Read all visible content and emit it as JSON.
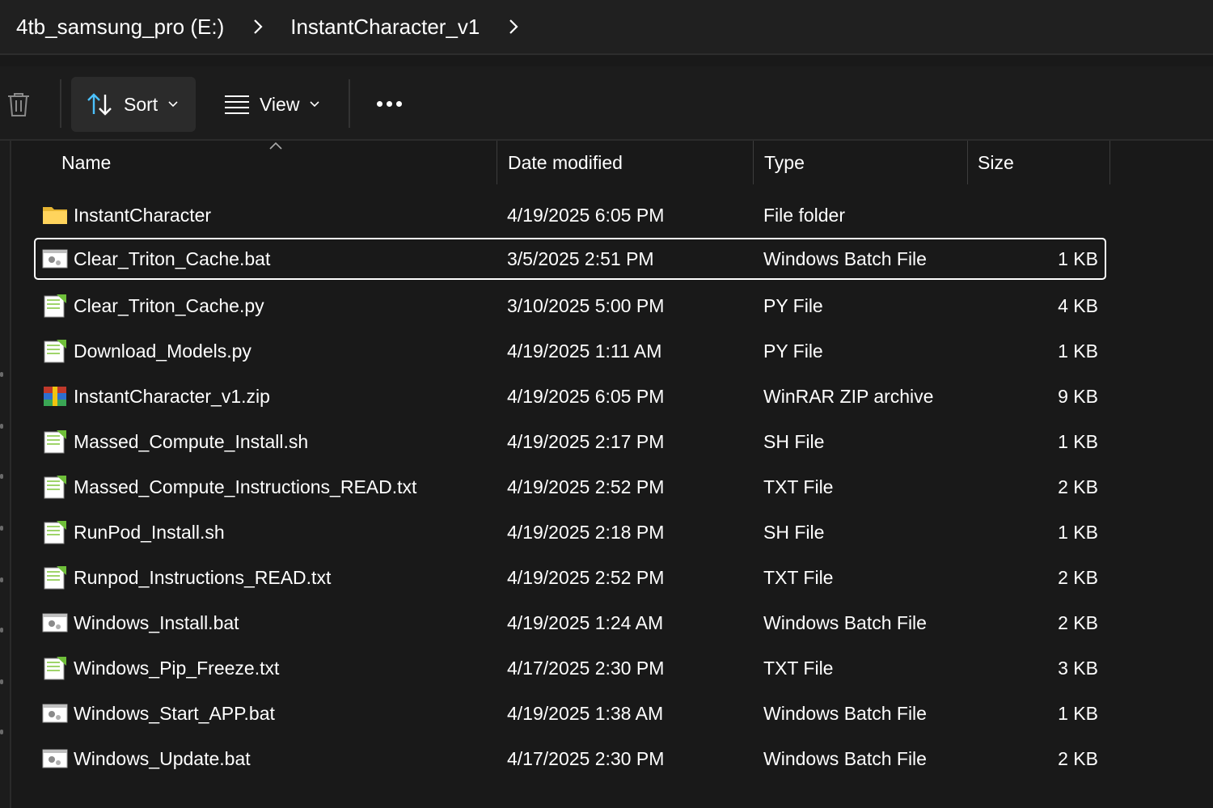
{
  "breadcrumb": {
    "items": [
      "4tb_samsung_pro (E:)",
      "InstantCharacter_v1"
    ]
  },
  "toolbar": {
    "sort_label": "Sort",
    "view_label": "View"
  },
  "columns": {
    "name": "Name",
    "date": "Date modified",
    "type": "Type",
    "size": "Size"
  },
  "files": [
    {
      "name": "InstantCharacter",
      "date": "4/19/2025 6:05 PM",
      "type": "File folder",
      "size": "",
      "icon": "folder-icon"
    },
    {
      "name": "Clear_Triton_Cache.bat",
      "date": "3/5/2025 2:51 PM",
      "type": "Windows Batch File",
      "size": "1 KB",
      "icon": "batch-file-icon"
    },
    {
      "name": "Clear_Triton_Cache.py",
      "date": "3/10/2025 5:00 PM",
      "type": "PY File",
      "size": "4 KB",
      "icon": "text-file-icon"
    },
    {
      "name": "Download_Models.py",
      "date": "4/19/2025 1:11 AM",
      "type": "PY File",
      "size": "1 KB",
      "icon": "text-file-icon"
    },
    {
      "name": "InstantCharacter_v1.zip",
      "date": "4/19/2025 6:05 PM",
      "type": "WinRAR ZIP archive",
      "size": "9 KB",
      "icon": "winrar-archive-icon"
    },
    {
      "name": "Massed_Compute_Install.sh",
      "date": "4/19/2025 2:17 PM",
      "type": "SH File",
      "size": "1 KB",
      "icon": "text-file-icon"
    },
    {
      "name": "Massed_Compute_Instructions_READ.txt",
      "date": "4/19/2025 2:52 PM",
      "type": "TXT File",
      "size": "2 KB",
      "icon": "text-file-icon"
    },
    {
      "name": "RunPod_Install.sh",
      "date": "4/19/2025 2:18 PM",
      "type": "SH File",
      "size": "1 KB",
      "icon": "text-file-icon"
    },
    {
      "name": "Runpod_Instructions_READ.txt",
      "date": "4/19/2025 2:52 PM",
      "type": "TXT File",
      "size": "2 KB",
      "icon": "text-file-icon"
    },
    {
      "name": "Windows_Install.bat",
      "date": "4/19/2025 1:24 AM",
      "type": "Windows Batch File",
      "size": "2 KB",
      "icon": "batch-file-icon"
    },
    {
      "name": "Windows_Pip_Freeze.txt",
      "date": "4/17/2025 2:30 PM",
      "type": "TXT File",
      "size": "3 KB",
      "icon": "text-file-icon"
    },
    {
      "name": "Windows_Start_APP.bat",
      "date": "4/19/2025 1:38 AM",
      "type": "Windows Batch File",
      "size": "1 KB",
      "icon": "batch-file-icon"
    },
    {
      "name": "Windows_Update.bat",
      "date": "4/17/2025 2:30 PM",
      "type": "Windows Batch File",
      "size": "2 KB",
      "icon": "batch-file-icon"
    }
  ],
  "colors": {
    "background": "#191919",
    "accent": "#4cc2ff",
    "folder": "#f3c94b"
  }
}
